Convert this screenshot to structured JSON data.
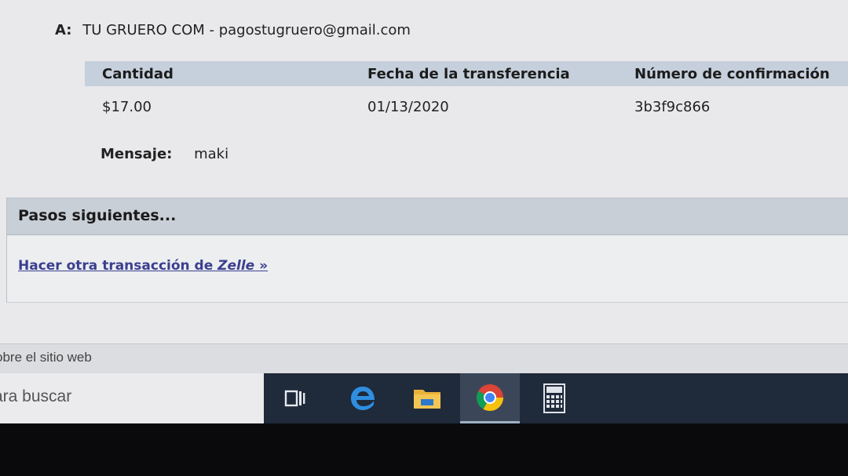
{
  "recipient": {
    "label": "A:",
    "value": "TU GRUERO COM - pagostugruero@gmail.com"
  },
  "table": {
    "headers": [
      "Cantidad",
      "Fecha de la transferencia",
      "Número de confirmación"
    ],
    "row": [
      "$17.00",
      "01/13/2020",
      "3b3f9c866"
    ]
  },
  "message": {
    "label": "Mensaje:",
    "value": "maki"
  },
  "next_steps": {
    "title": "Pasos siguientes...",
    "link_prefix": "Hacer otra transacción de ",
    "link_brand": "Zelle",
    "link_suffix": " »"
  },
  "footer": {
    "link": "obre el sitio web"
  },
  "taskbar": {
    "search_text": "ara buscar",
    "icons": [
      "task-view-icon",
      "edge-icon",
      "file-explorer-icon",
      "chrome-icon",
      "calculator-icon"
    ]
  },
  "colors": {
    "header_bg": "#c6d0dc",
    "link": "#3b3f8f",
    "taskbar": "#1f2a3a"
  }
}
